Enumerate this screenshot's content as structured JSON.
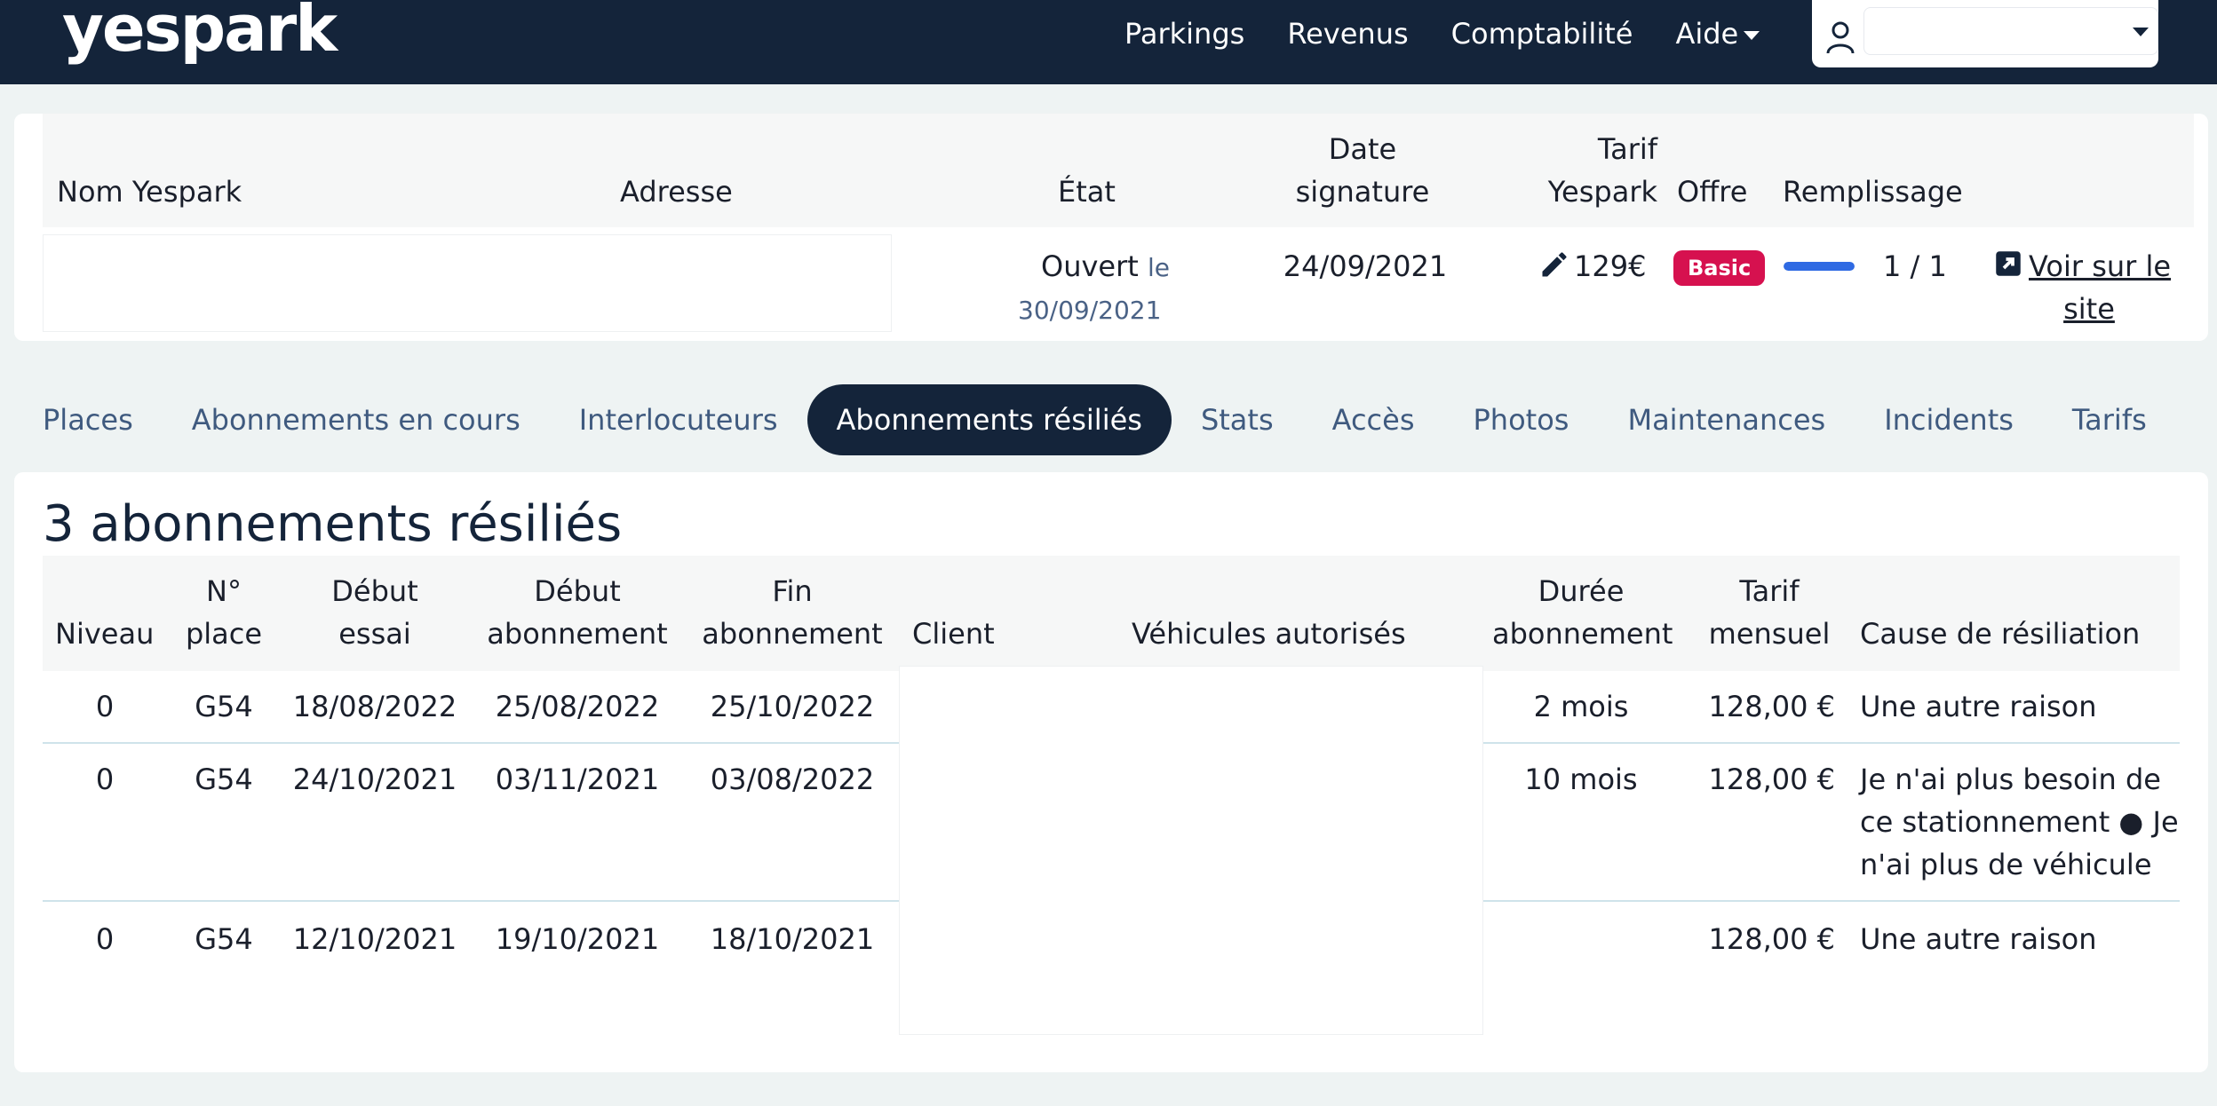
{
  "nav": {
    "logo": "yespark",
    "links": [
      "Parkings",
      "Revenus",
      "Comptabilité",
      "Aide"
    ]
  },
  "parking": {
    "headers": {
      "nom": "Nom Yespark",
      "adresse": "Adresse",
      "etat": "État",
      "date_sig_1": "Date",
      "date_sig_2": "signature",
      "tarif_1": "Tarif",
      "tarif_2": "Yespark",
      "offre": "Offre",
      "remplissage": "Remplissage"
    },
    "etat": "Ouvert",
    "etat_le": "le",
    "etat_date": "30/09/2021",
    "date_signature": "24/09/2021",
    "tarif": "129€",
    "offre": "Basic",
    "remplissage": "1 / 1",
    "remplissage_ratio": 1.0,
    "voir_1": "Voir sur le",
    "voir_2": "site"
  },
  "tabs": [
    {
      "label": "Places"
    },
    {
      "label": "Abonnements en cours"
    },
    {
      "label": "Interlocuteurs"
    },
    {
      "label": "Abonnements résiliés",
      "active": true
    },
    {
      "label": "Stats"
    },
    {
      "label": "Accès"
    },
    {
      "label": "Photos"
    },
    {
      "label": "Maintenances"
    },
    {
      "label": "Incidents"
    },
    {
      "label": "Tarifs"
    }
  ],
  "section_title": "3 abonnements résiliés",
  "table": {
    "headers": {
      "niveau": "Niveau",
      "place_1": "N°",
      "place_2": "place",
      "debut_essai_1": "Début",
      "debut_essai_2": "essai",
      "debut_abo_1": "Début",
      "debut_abo_2": "abonnement",
      "fin_abo_1": "Fin",
      "fin_abo_2": "abonnement",
      "client": "Client",
      "vehicules": "Véhicules autorisés",
      "duree_1": "Durée",
      "duree_2": "abonnement",
      "tarif_1": "Tarif",
      "tarif_2": "mensuel",
      "cause": "Cause de résiliation"
    },
    "rows": [
      {
        "niveau": "0",
        "place": "G54",
        "debut_essai": "18/08/2022",
        "debut_abo": "25/08/2022",
        "fin_abo": "25/10/2022",
        "duree": "2 mois",
        "tarif": "128,00 €",
        "cause": [
          "Une autre raison"
        ]
      },
      {
        "niveau": "0",
        "place": "G54",
        "debut_essai": "24/10/2021",
        "debut_abo": "03/11/2021",
        "fin_abo": "03/08/2022",
        "duree": "10 mois",
        "tarif": "128,00 €",
        "cause": [
          "Je n'ai plus besoin de",
          "ce stationnement ● Je",
          "n'ai plus de véhicule"
        ]
      },
      {
        "niveau": "0",
        "place": "G54",
        "debut_essai": "12/10/2021",
        "debut_abo": "19/10/2021",
        "fin_abo": "18/10/2021",
        "duree": "",
        "tarif": "128,00 €",
        "cause": [
          "Une autre raison"
        ]
      }
    ]
  },
  "colors": {
    "navbar": "#14243a",
    "badge": "#d6114f",
    "progress": "#2f6ae3",
    "tab_text": "#3f5a7f"
  }
}
